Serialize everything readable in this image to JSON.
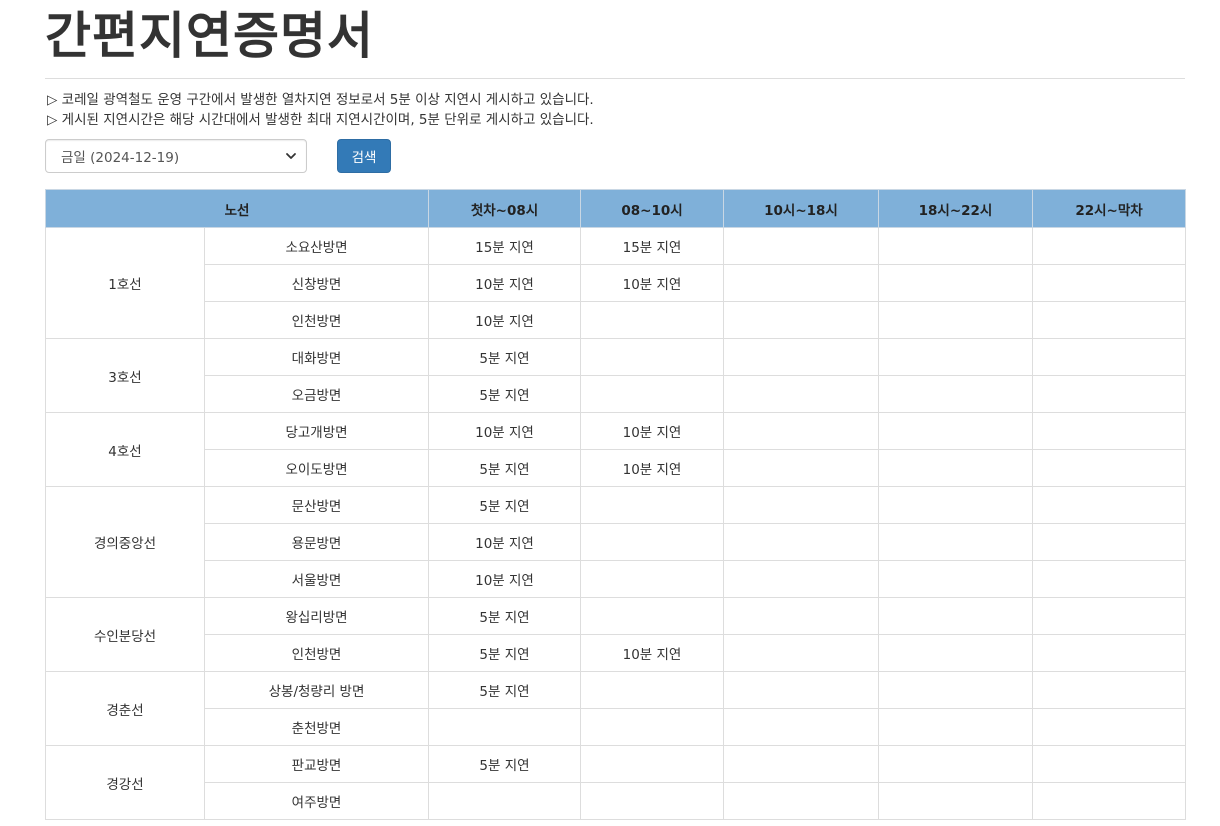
{
  "page": {
    "title": "간편지연증명서",
    "notices": [
      "▷ 코레일 광역철도 운영 구간에서 발생한 열차지연 정보로서 5분 이상 지연시 게시하고 있습니다.",
      "▷ 게시된 지연시간은 해당 시간대에서 발생한 최대 지연시간이며, 5분 단위로 게시하고 있습니다."
    ]
  },
  "form": {
    "selected_date": "금일 (2024-12-19)",
    "search_label": "검색"
  },
  "table": {
    "headers": [
      "노선",
      "첫차~08시",
      "08~10시",
      "10시~18시",
      "18시~22시",
      "22시~막차"
    ],
    "lines": [
      {
        "name": "1호선",
        "directions": [
          {
            "name": "소요산방면",
            "delays": [
              "15분 지연",
              "15분 지연",
              "",
              "",
              ""
            ]
          },
          {
            "name": "신창방면",
            "delays": [
              "10분 지연",
              "10분 지연",
              "",
              "",
              ""
            ]
          },
          {
            "name": "인천방면",
            "delays": [
              "10분 지연",
              "",
              "",
              "",
              ""
            ]
          }
        ]
      },
      {
        "name": "3호선",
        "directions": [
          {
            "name": "대화방면",
            "delays": [
              "5분 지연",
              "",
              "",
              "",
              ""
            ]
          },
          {
            "name": "오금방면",
            "delays": [
              "5분 지연",
              "",
              "",
              "",
              ""
            ]
          }
        ]
      },
      {
        "name": "4호선",
        "directions": [
          {
            "name": "당고개방면",
            "delays": [
              "10분 지연",
              "10분 지연",
              "",
              "",
              ""
            ]
          },
          {
            "name": "오이도방면",
            "delays": [
              "5분 지연",
              "10분 지연",
              "",
              "",
              ""
            ]
          }
        ]
      },
      {
        "name": "경의중앙선",
        "directions": [
          {
            "name": "문산방면",
            "delays": [
              "5분 지연",
              "",
              "",
              "",
              ""
            ]
          },
          {
            "name": "용문방면",
            "delays": [
              "10분 지연",
              "",
              "",
              "",
              ""
            ]
          },
          {
            "name": "서울방면",
            "delays": [
              "10분 지연",
              "",
              "",
              "",
              ""
            ]
          }
        ]
      },
      {
        "name": "수인분당선",
        "directions": [
          {
            "name": "왕십리방면",
            "delays": [
              "5분 지연",
              "",
              "",
              "",
              ""
            ]
          },
          {
            "name": "인천방면",
            "delays": [
              "5분 지연",
              "10분 지연",
              "",
              "",
              ""
            ]
          }
        ]
      },
      {
        "name": "경춘선",
        "directions": [
          {
            "name": "상봉/청량리 방면",
            "delays": [
              "5분 지연",
              "",
              "",
              "",
              ""
            ]
          },
          {
            "name": "춘천방면",
            "delays": [
              "",
              "",
              "",
              "",
              ""
            ]
          }
        ]
      },
      {
        "name": "경강선",
        "directions": [
          {
            "name": "판교방면",
            "delays": [
              "5분 지연",
              "",
              "",
              "",
              ""
            ]
          },
          {
            "name": "여주방면",
            "delays": [
              "",
              "",
              "",
              "",
              ""
            ]
          }
        ]
      }
    ]
  },
  "colors": {
    "header_bg": "#7fb0d9",
    "delay_text": "#337ab7",
    "button_bg": "#337ab7"
  }
}
